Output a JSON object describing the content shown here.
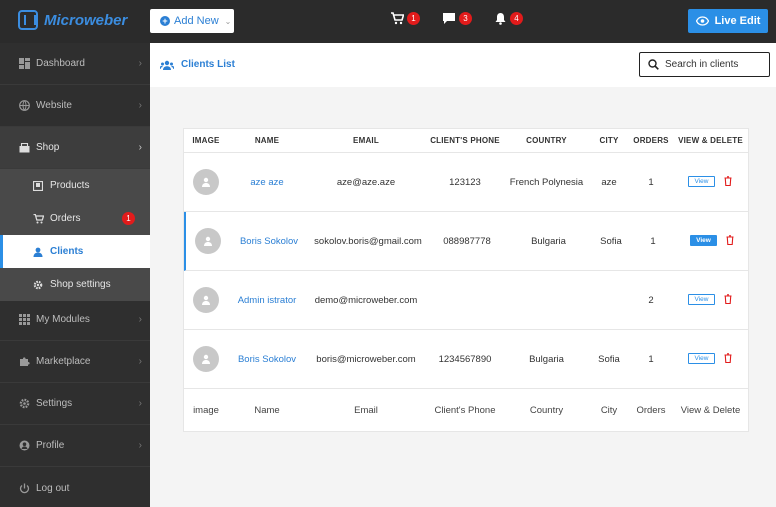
{
  "topbar": {
    "logo_text": "Microweber",
    "add_new_label": "Add New",
    "cart_count": "1",
    "comments_count": "3",
    "notifications_count": "4",
    "live_edit_label": "Live Edit"
  },
  "sidebar": {
    "dashboard": "Dashboard",
    "website": "Website",
    "shop": "Shop",
    "products": "Products",
    "orders": "Orders",
    "orders_badge": "1",
    "clients": "Clients",
    "shop_settings": "Shop settings",
    "my_modules": "My Modules",
    "marketplace": "Marketplace",
    "settings": "Settings",
    "profile": "Profile",
    "logout": "Log out"
  },
  "main": {
    "title": "Clients List",
    "search_placeholder": "Search in clients"
  },
  "table": {
    "headers": {
      "image": "IMAGE",
      "name": "NAME",
      "email": "EMAIL",
      "phone": "CLIENT'S PHONE",
      "country": "COUNTRY",
      "city": "CITY",
      "orders": "ORDERS",
      "view": "VIEW & DELETE"
    },
    "view_label": "View",
    "rows": [
      {
        "name": "aze aze",
        "email": "aze@aze.aze",
        "phone": "123123",
        "country": "French Polynesia",
        "city": "aze",
        "orders": "1"
      },
      {
        "name": "Boris Sokolov",
        "email": "sokolov.boris@gmail.com",
        "phone": "088987778",
        "country": "Bulgaria",
        "city": "Sofia",
        "orders": "1"
      },
      {
        "name": "Admin istrator",
        "email": "demo@microweber.com",
        "phone": "",
        "country": "",
        "city": "",
        "orders": "2"
      },
      {
        "name": "Boris Sokolov",
        "email": "boris@microweber.com",
        "phone": "1234567890",
        "country": "Bulgaria",
        "city": "Sofia",
        "orders": "1"
      }
    ],
    "footer": {
      "image": "image",
      "name": "Name",
      "email": "Email",
      "phone": "Client's Phone",
      "country": "Country",
      "city": "City",
      "orders": "Orders",
      "view": "View & Delete"
    }
  },
  "colors": {
    "accent": "#2b8fe6",
    "badge": "#e21b1b",
    "sidebar": "#2f2f2f"
  }
}
